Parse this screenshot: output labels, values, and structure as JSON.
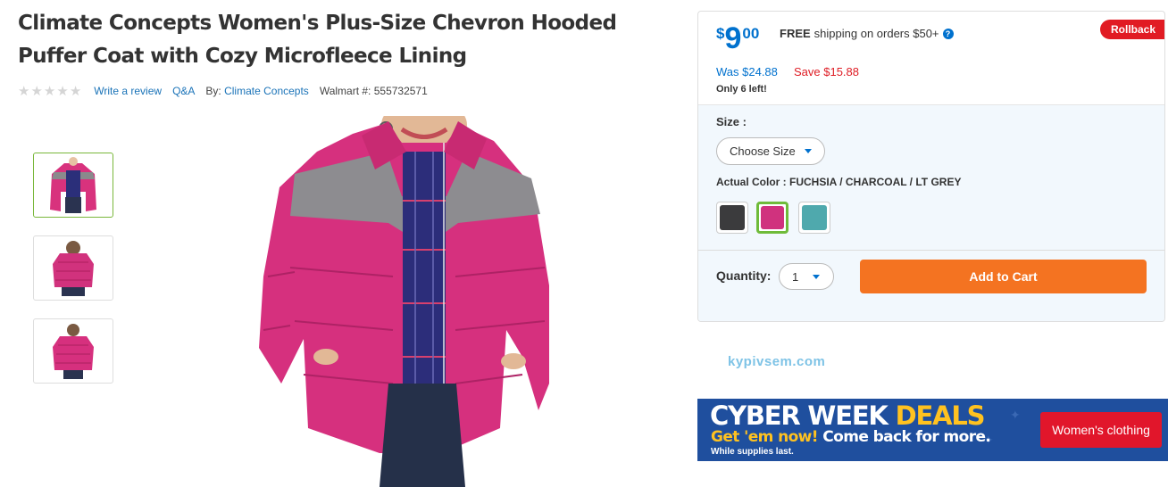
{
  "product": {
    "title": "Climate Concepts Women's Plus-Size Chevron Hooded Puffer Coat with Cozy Microfleece Lining",
    "rating_stars": 0,
    "write_review": "Write a review",
    "qa": "Q&A",
    "by_label": "By:",
    "brand": "Climate Concepts",
    "walmart_label": "Walmart #:",
    "walmart_number": "555732571"
  },
  "gallery": {
    "thumbnails": [
      "front",
      "back",
      "front-alt"
    ],
    "selected_index": 0
  },
  "buybox": {
    "price_currency": "$",
    "price_dollars": "9",
    "price_cents": "00",
    "shipping_free": "FREE",
    "shipping_text": "shipping on orders $50+",
    "help_icon": "?",
    "rollback_badge": "Rollback",
    "was_price": "Was $24.88",
    "save_text": "Save $15.88",
    "stock_text": "Only 6 left!",
    "size_label": "Size :",
    "size_select": "Choose Size",
    "color_label": "Actual Color :",
    "color_value": "FUCHSIA / CHARCOAL / LT GREY",
    "swatches": [
      {
        "color": "#3b3b3d",
        "selected": false
      },
      {
        "color": "#d0327e",
        "selected": true
      },
      {
        "color": "#4fa9ad",
        "selected": false
      }
    ],
    "quantity_label": "Quantity:",
    "quantity_value": "1",
    "add_to_cart": "Add to Cart"
  },
  "watermark": "kypivsem.com",
  "banner": {
    "line1_a": "CYBER WEEK",
    "line1_b": "DEALS",
    "line2_a": "Get 'em now!",
    "line2_b": "Come back for more.",
    "line3": "While supplies last.",
    "button": "Women's clothing"
  },
  "colors": {
    "brand_blue": "#0071ce",
    "cta_orange": "#f47321",
    "rollback_red": "#e11b23",
    "selected_green": "#6fbb3a"
  }
}
